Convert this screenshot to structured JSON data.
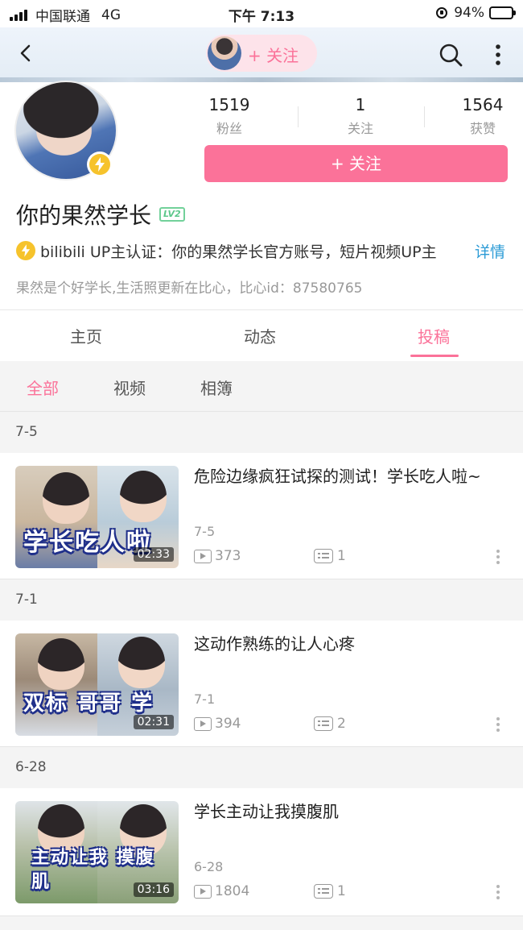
{
  "status_bar": {
    "carrier": "中国联通",
    "network": "4G",
    "time": "下午 7:13",
    "battery_percent": "94%",
    "battery_level": 0.94
  },
  "nav": {
    "back_icon": "chevron-left-icon",
    "follow_pill_label": "+ 关注",
    "search_icon": "search-icon",
    "more_icon": "more-vertical-icon"
  },
  "profile": {
    "stats": [
      {
        "value": "1519",
        "label": "粉丝"
      },
      {
        "value": "1",
        "label": "关注"
      },
      {
        "value": "1564",
        "label": "获赞"
      }
    ],
    "follow_button": "+ 关注",
    "name": "你的果然学长",
    "level": "LV2",
    "certification": "bilibili  UP主认证：你的果然学长官方账号，短片视频UP主",
    "detail_link": "详情",
    "signature": "果然是个好学长,生活照更新在比心，比心id：87580765",
    "accent": "#fb7299"
  },
  "tabs": [
    {
      "label": "主页",
      "active": false
    },
    {
      "label": "动态",
      "active": false
    },
    {
      "label": "投稿",
      "active": true
    }
  ],
  "subtabs": [
    {
      "label": "全部",
      "active": true
    },
    {
      "label": "视频",
      "active": false
    },
    {
      "label": "相簿",
      "active": false
    }
  ],
  "videos": [
    {
      "group_date": "7-5",
      "title": "危险边缘疯狂试探的测试！学长吃人啦~",
      "date": "7-5",
      "duration": "02:33",
      "plays": "373",
      "comments": "1",
      "thumb_caption": "学长吃人啦"
    },
    {
      "group_date": "7-1",
      "title": "这动作熟练的让人心疼",
      "date": "7-1",
      "duration": "02:31",
      "plays": "394",
      "comments": "2",
      "thumb_caption": "双标 哥哥 学"
    },
    {
      "group_date": "6-28",
      "title": "学长主动让我摸腹肌",
      "date": "6-28",
      "duration": "03:16",
      "plays": "1804",
      "comments": "1",
      "thumb_caption": "主动让我 摸腹肌"
    }
  ]
}
